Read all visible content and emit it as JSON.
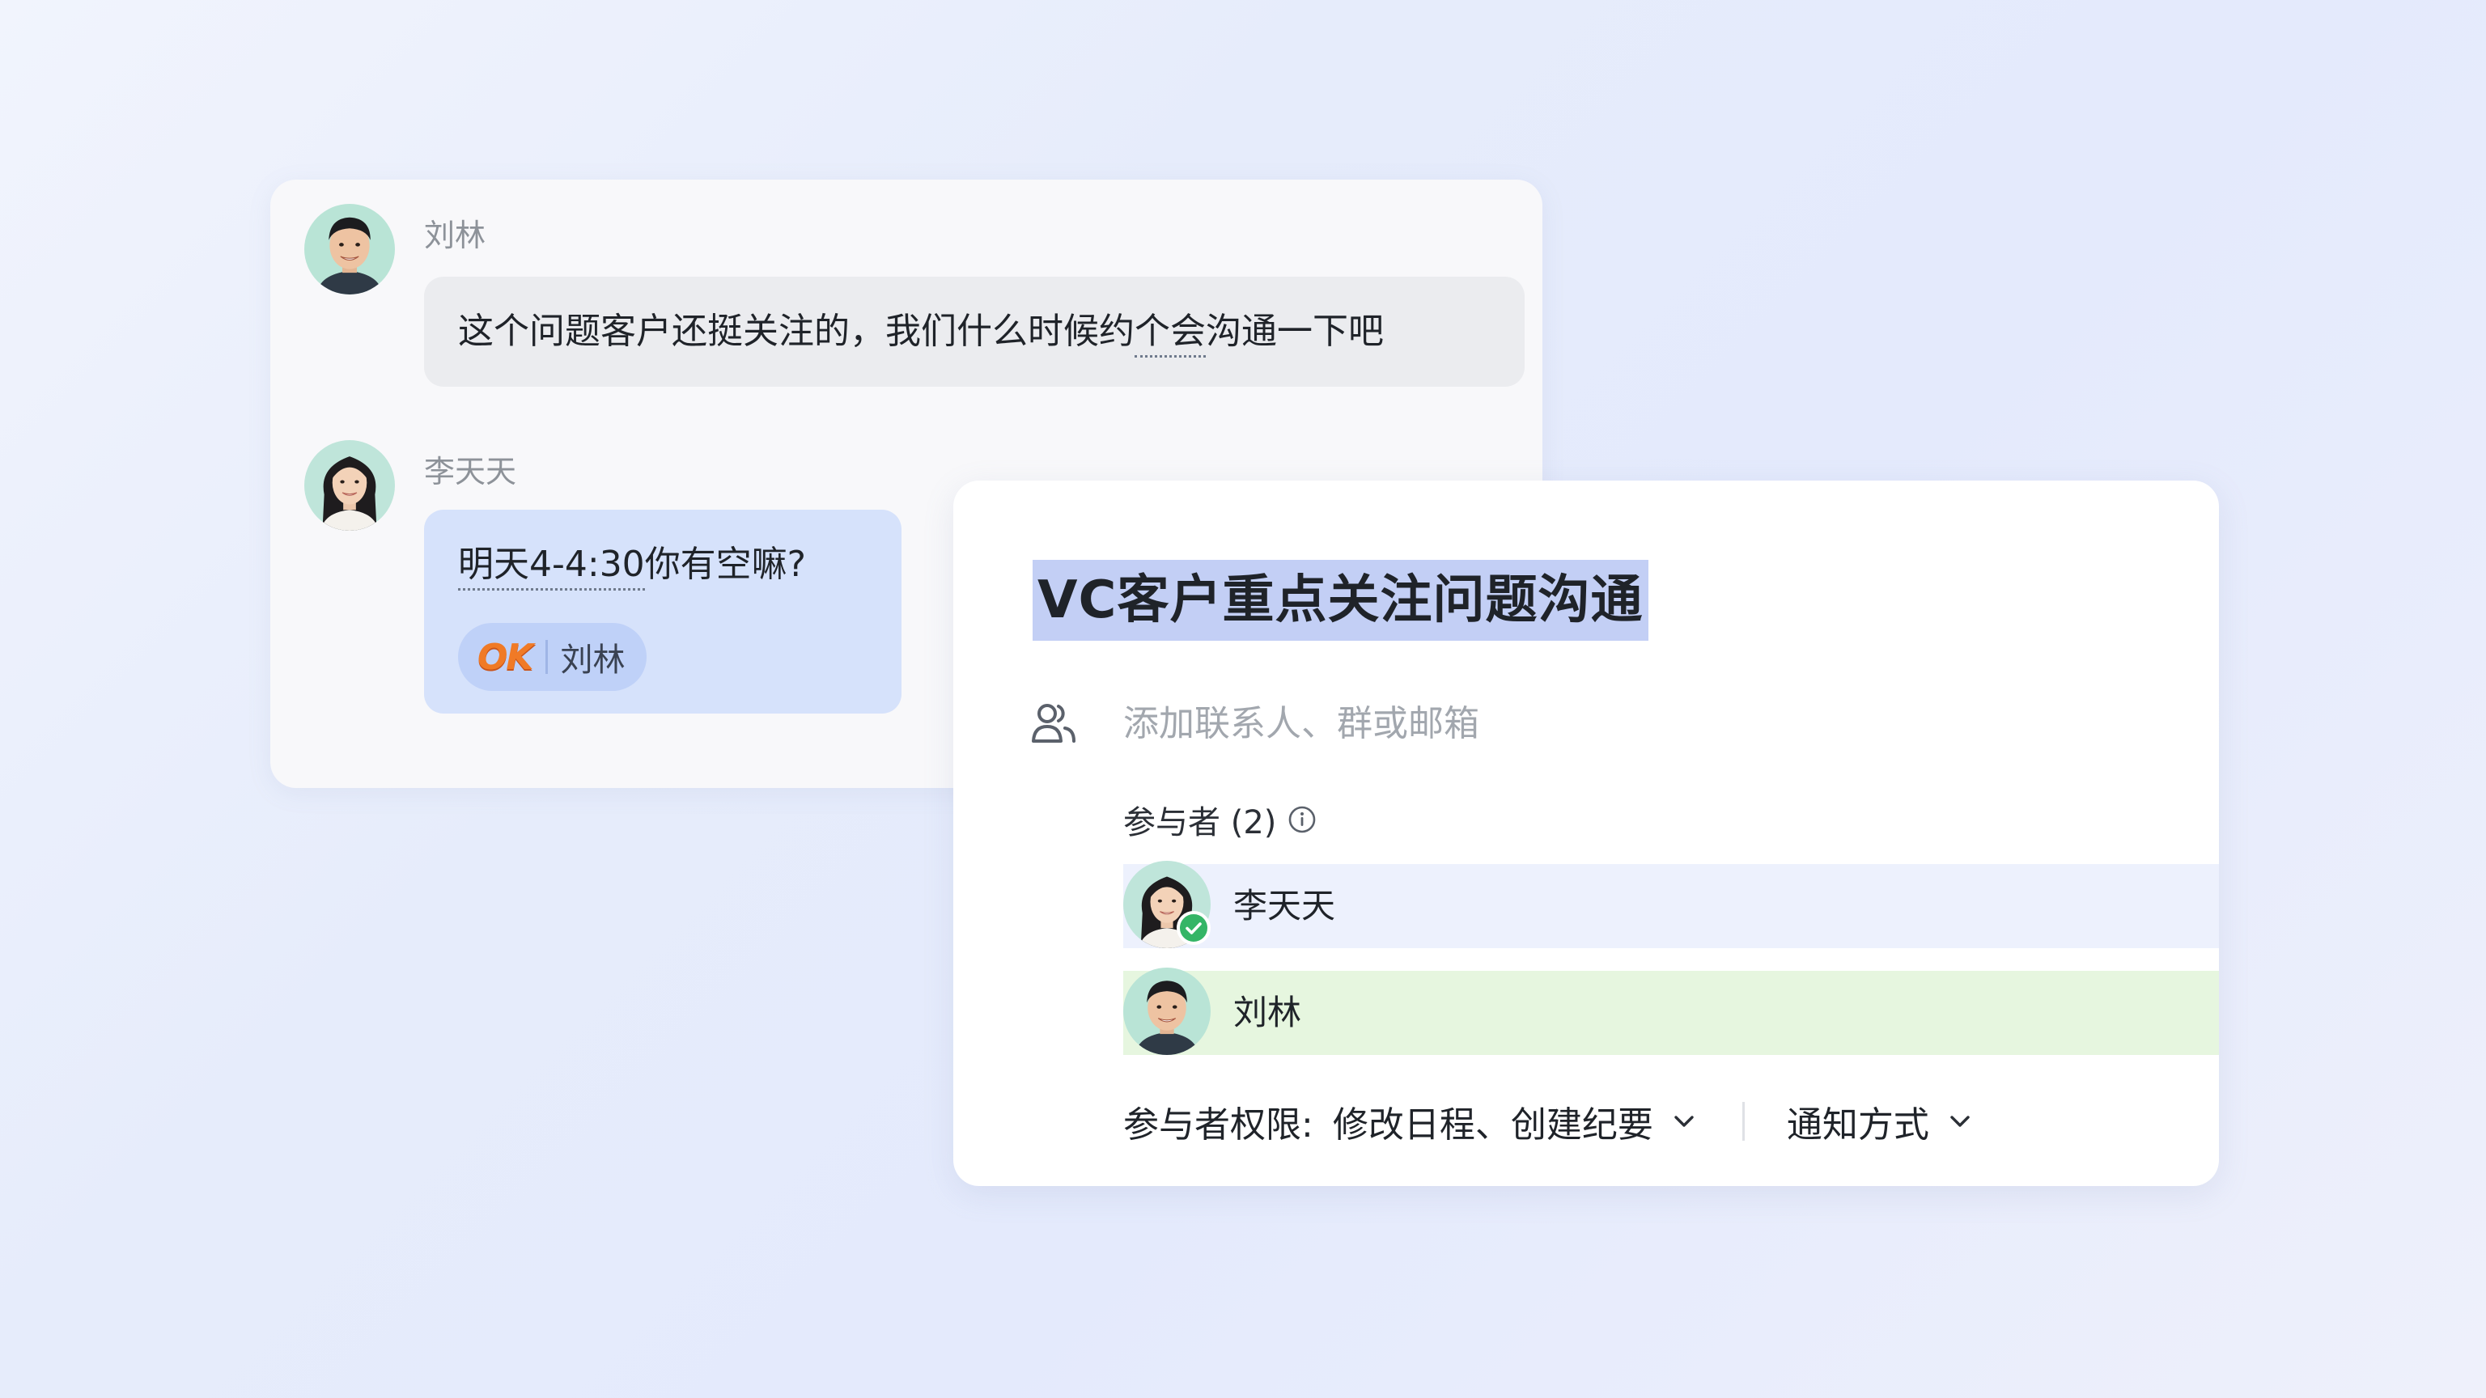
{
  "chat": {
    "messages": [
      {
        "sender": "刘林",
        "text_before": "这个问题客户还挺关注的，我们什么时候约",
        "text_linked": "个会",
        "text_after": "沟通一下吧"
      },
      {
        "sender": "李天天",
        "text_linked": "明天4-4:30",
        "text_after": "你有空嘛?",
        "reaction": {
          "emoji": "OK",
          "user": "刘林"
        }
      }
    ]
  },
  "event": {
    "title": "VC客户重点关注问题沟通",
    "contact_input_placeholder": "添加联系人、群或邮箱",
    "participants_label": "参与者 (2)",
    "participants": [
      {
        "name": "李天天",
        "accepted": true,
        "row_color": "#edf1fd"
      },
      {
        "name": "刘林",
        "accepted": false,
        "row_color": "#e6f6df"
      }
    ],
    "permission_label": "参与者权限:",
    "permission_value": "修改日程、创建纪要",
    "notify_label": "通知方式"
  },
  "colors": {
    "highlight": "#c3cff5",
    "bubble_blue": "#d6e2fb",
    "accept_green": "#34b566"
  },
  "icons": [
    "contacts-icon",
    "info-icon",
    "check-icon",
    "eye-icon",
    "close-icon",
    "chevron-down-icon",
    "sync-ring-icon"
  ]
}
